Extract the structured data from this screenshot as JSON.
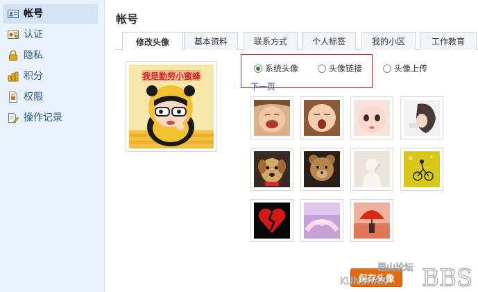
{
  "sidebar": {
    "items": [
      {
        "label": "帐号",
        "icon": "id-card-icon",
        "active": true
      },
      {
        "label": "认证",
        "icon": "certificate-icon",
        "active": false
      },
      {
        "label": "隐私",
        "icon": "lock-icon",
        "active": false
      },
      {
        "label": "积分",
        "icon": "coins-icon",
        "active": false
      },
      {
        "label": "权限",
        "icon": "permission-icon",
        "active": false
      },
      {
        "label": "操作记录",
        "icon": "edit-log-icon",
        "active": false
      }
    ]
  },
  "main": {
    "title": "帐号",
    "tabs": [
      {
        "label": "修改头像",
        "active": true
      },
      {
        "label": "基本资料",
        "active": false
      },
      {
        "label": "联系方式",
        "active": false
      },
      {
        "label": "个人标签",
        "active": false
      },
      {
        "label": "我的小区",
        "active": false
      },
      {
        "label": "工作教育",
        "active": false
      }
    ],
    "avatar_text": "我是勤劳小蜜蜂",
    "radio_options": [
      {
        "label": "系统头像",
        "checked": true
      },
      {
        "label": "头像链接",
        "checked": false
      },
      {
        "label": "头像上传",
        "checked": false
      }
    ],
    "next_page": "下一页",
    "thumbnails": [
      "laughing-baby",
      "yawning-baby",
      "baby-face",
      "girl-hair",
      "puppy",
      "teddy-bear",
      "faded-figure",
      "cyclist-field",
      "broken-heart",
      "holding-hands",
      "red-umbrella"
    ],
    "save_label": "保存头像"
  },
  "watermark": {
    "line1": "昆山论坛",
    "line2": "KUNSHAN",
    "line3": "BBS"
  },
  "colors": {
    "sidebar_bg": "#e9f1fb",
    "accent_red": "#c4262e",
    "button_orange": "#e36b0c",
    "link_blue": "#1a4f9c"
  }
}
